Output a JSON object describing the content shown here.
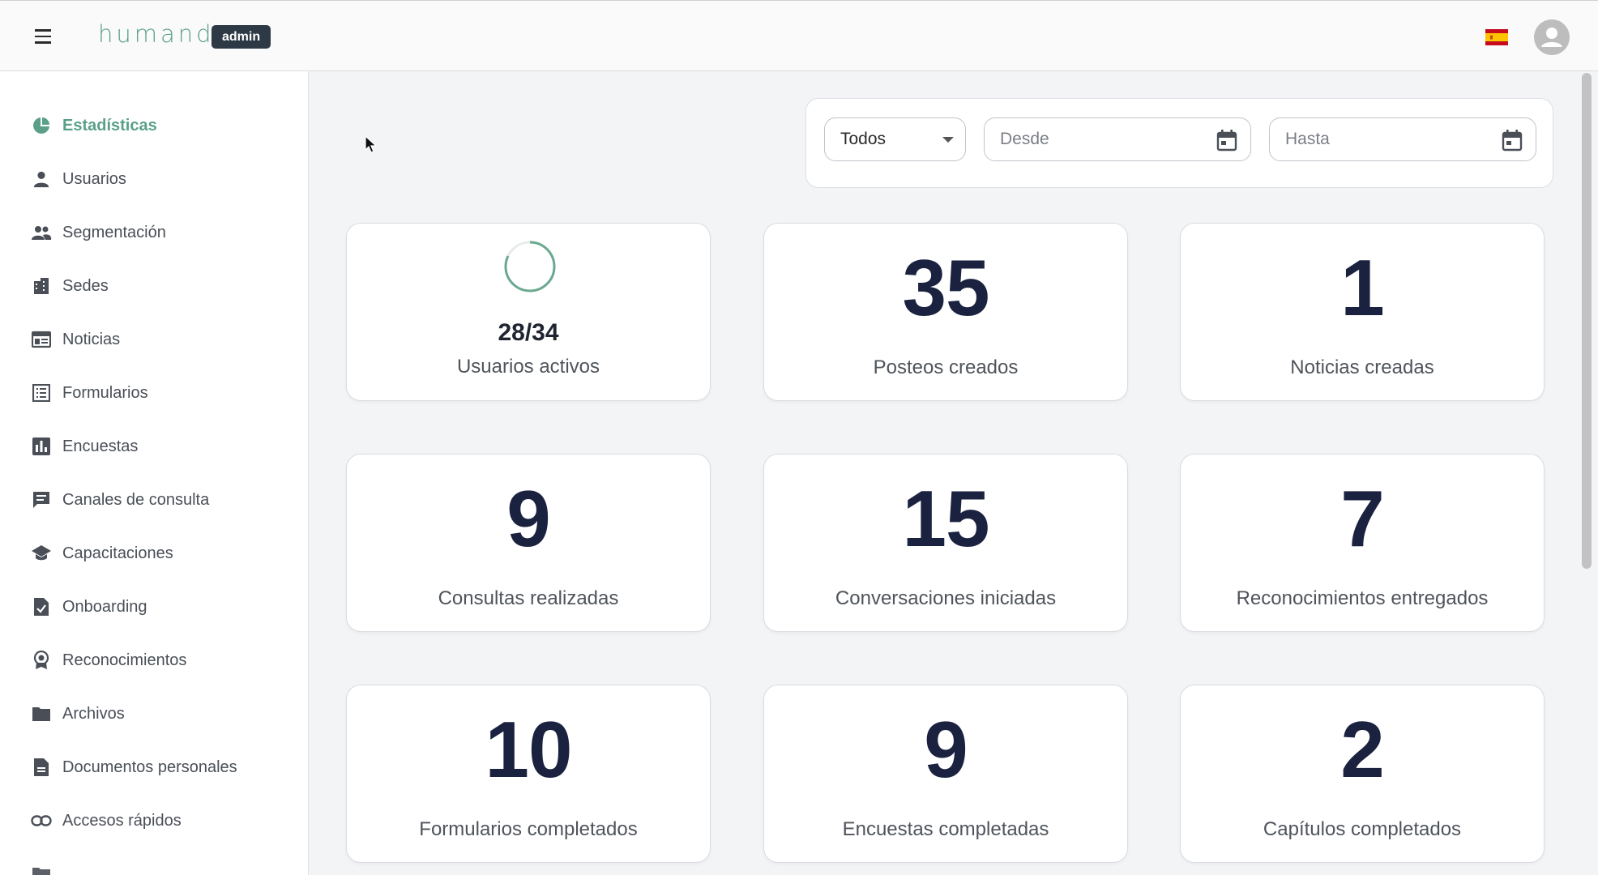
{
  "header": {
    "logo_text": "humand",
    "admin_badge": "admin",
    "language_flag": "spain-flag-icon",
    "avatar_icon": "user-avatar-icon",
    "menu_icon": "hamburger-menu-icon"
  },
  "colors": {
    "brand_green": "#5aa088",
    "number_navy": "#1a2240",
    "admin_badge_bg": "#2d3a45"
  },
  "sidebar": {
    "items": [
      {
        "label": "Estadísticas",
        "icon": "pie-chart-icon",
        "active": true
      },
      {
        "label": "Usuarios",
        "icon": "person-icon"
      },
      {
        "label": "Segmentación",
        "icon": "people-group-icon"
      },
      {
        "label": "Sedes",
        "icon": "building-icon"
      },
      {
        "label": "Noticias",
        "icon": "newspaper-icon"
      },
      {
        "label": "Formularios",
        "icon": "form-list-icon"
      },
      {
        "label": "Encuestas",
        "icon": "bar-chart-icon"
      },
      {
        "label": "Canales de consulta",
        "icon": "chat-message-icon"
      },
      {
        "label": "Capacitaciones",
        "icon": "graduation-cap-icon"
      },
      {
        "label": "Onboarding",
        "icon": "checklist-document-icon"
      },
      {
        "label": "Reconocimientos",
        "icon": "award-badge-icon"
      },
      {
        "label": "Archivos",
        "icon": "folder-icon"
      },
      {
        "label": "Documentos personales",
        "icon": "document-icon"
      },
      {
        "label": "Accesos rápidos",
        "icon": "link-icon"
      }
    ]
  },
  "filters": {
    "segment_select": {
      "value": "Todos"
    },
    "date_from": {
      "placeholder": "Desde",
      "icon": "calendar-icon"
    },
    "date_to": {
      "placeholder": "Hasta",
      "icon": "calendar-icon"
    }
  },
  "stats": {
    "active_users": {
      "ratio": "28/34",
      "label": "Usuarios activos",
      "fraction": 0.82
    },
    "cards": [
      {
        "value": "35",
        "label": "Posteos creados"
      },
      {
        "value": "1",
        "label": "Noticias creadas"
      },
      {
        "value": "9",
        "label": "Consultas realizadas"
      },
      {
        "value": "15",
        "label": "Conversaciones iniciadas"
      },
      {
        "value": "7",
        "label": "Reconocimientos entregados"
      },
      {
        "value": "10",
        "label": "Formularios completados"
      },
      {
        "value": "9",
        "label": "Encuestas completadas"
      },
      {
        "value": "2",
        "label": "Capítulos completados"
      }
    ]
  }
}
